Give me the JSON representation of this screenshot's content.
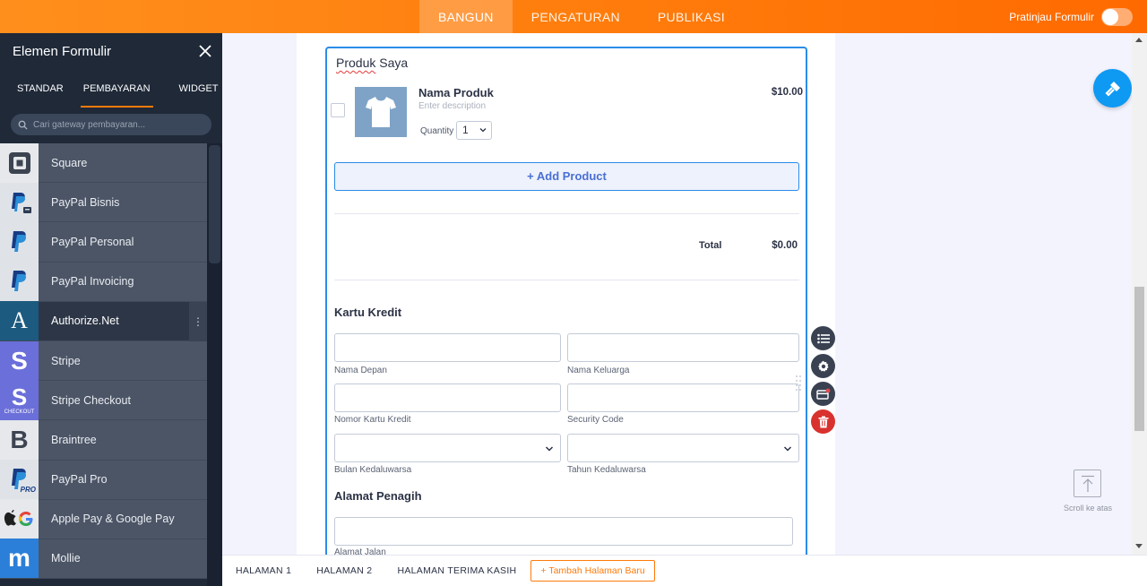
{
  "topbar": {
    "tabs": [
      {
        "label": "BANGUN",
        "active": true
      },
      {
        "label": "PENGATURAN",
        "active": false
      },
      {
        "label": "PUBLIKASI",
        "active": false
      }
    ],
    "preview_label": "Pratinjau Formulir",
    "preview_on": false
  },
  "sidebar": {
    "title": "Elemen Formulir",
    "tabs": [
      {
        "label": "STANDAR",
        "active": false
      },
      {
        "label": "PEMBAYARAN",
        "active": true
      },
      {
        "label": "WIDGET",
        "active": false
      }
    ],
    "search_placeholder": "Cari gateway pembayaran...",
    "items": [
      {
        "label": "Square",
        "icon": "square-logo-icon"
      },
      {
        "label": "PayPal Bisnis",
        "icon": "paypal-business-icon"
      },
      {
        "label": "PayPal Personal",
        "icon": "paypal-icon"
      },
      {
        "label": "PayPal Invoicing",
        "icon": "paypal-icon"
      },
      {
        "label": "Authorize.Net",
        "icon": "authorize-net-icon",
        "selected": true
      },
      {
        "label": "Stripe",
        "icon": "stripe-icon"
      },
      {
        "label": "Stripe Checkout",
        "icon": "stripe-checkout-icon",
        "icon_text": "CHECKOUT"
      },
      {
        "label": "Braintree",
        "icon": "braintree-icon"
      },
      {
        "label": "PayPal Pro",
        "icon": "paypal-pro-icon",
        "icon_text": "PRO"
      },
      {
        "label": "Apple Pay & Google Pay",
        "icon": "apple-google-pay-icon"
      },
      {
        "label": "Mollie",
        "icon": "mollie-icon"
      }
    ],
    "more_label": "⋮"
  },
  "form": {
    "product_section_title_part1": "Produk",
    "product_section_title_part2": " Saya",
    "product": {
      "name": "Nama Produk",
      "description": "Enter description",
      "quantity_label": "Quantity",
      "quantity_value": "1",
      "price": "$10.00"
    },
    "add_product_label": "+ Add Product",
    "total_label": "Total",
    "total_value": "$0.00",
    "credit_card_title": "Kartu Kredit",
    "fields": {
      "first_name": "Nama Depan",
      "last_name": "Nama Keluarga",
      "card_number": "Nomor Kartu Kredit",
      "security_code": "Security Code",
      "expiry_month": "Bulan Kedaluwarsa",
      "expiry_year": "Tahun Kedaluwarsa"
    },
    "billing_title": "Alamat Penagih",
    "street_label": "Alamat Jalan"
  },
  "scroll_top_label": "Scroll ke atas",
  "bottombar": {
    "tabs": [
      "HALAMAN 1",
      "HALAMAN 2",
      "HALAMAN TERIMA KASIH"
    ],
    "new_page_label": "+ Tambah Halaman Baru"
  },
  "colors": {
    "accent": "#ff7a0a",
    "selection_blue": "#2a8ce8",
    "sidebar_bg": "#1f2938",
    "delete_red": "#d9322e"
  }
}
